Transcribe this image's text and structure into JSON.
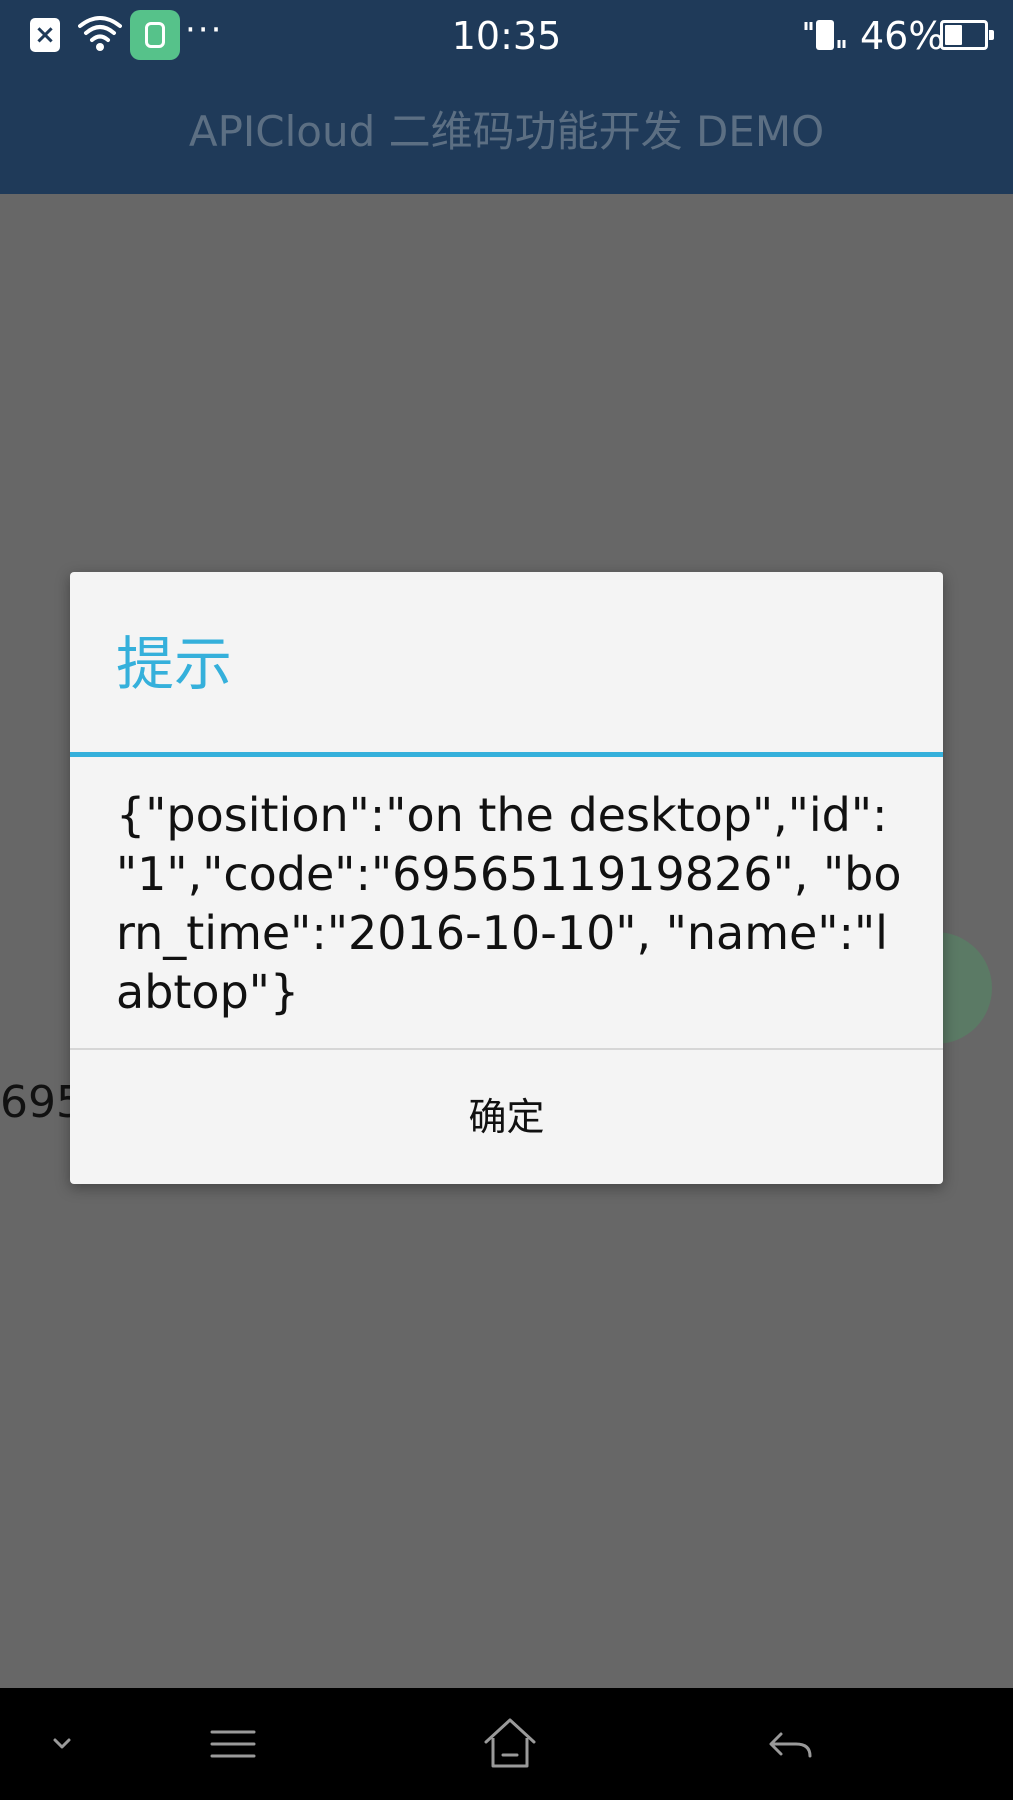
{
  "status_bar": {
    "notification_icons": [
      "close-notification-icon",
      "wifi-icon",
      "app-notification-icon",
      "more-dots-icon"
    ],
    "more_dots": "···",
    "time": "10:35",
    "battery_percent": "46%",
    "battery_level": 0.46
  },
  "header": {
    "title": "APICloud 二维码功能开发 DEMO"
  },
  "background": {
    "partial_number": "695"
  },
  "dialog": {
    "title": "提示",
    "message": "{\"position\":\"on the desktop\",\"id\": \"1\",\"code\":\"6956511919826\", \"born_time\":\"2016-10-10\", \"name\":\"labtop\"}",
    "confirm_label": "确定"
  },
  "nav_bar": {
    "buttons": [
      "collapse-icon",
      "menu-icon",
      "home-icon",
      "back-icon"
    ]
  },
  "colors": {
    "status_bar_bg": "#1f3a59",
    "accent": "#35b0db",
    "overlay": "#676767",
    "dialog_bg": "#f4f4f4"
  }
}
